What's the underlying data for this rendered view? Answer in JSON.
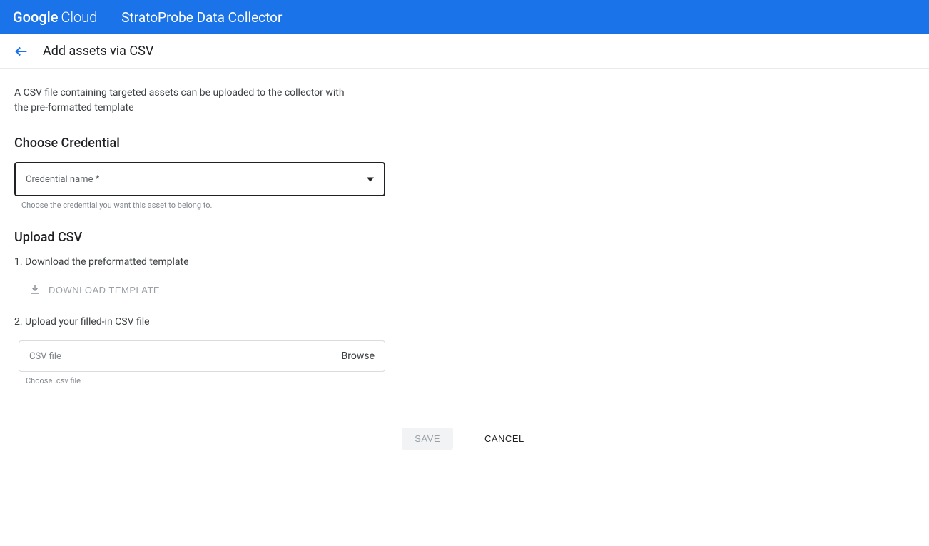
{
  "header": {
    "logo_bold": "Google",
    "logo_light": "Cloud",
    "product_name": "StratoProbe Data Collector"
  },
  "subheader": {
    "title": "Add assets via CSV"
  },
  "main": {
    "intro": "A CSV file containing targeted assets can be uploaded to the collector with the pre-formatted template",
    "credential": {
      "section_title": "Choose Credential",
      "label": "Credential name *",
      "helper": "Choose the credential you want this asset to belong to."
    },
    "upload": {
      "section_title": "Upload CSV",
      "step1": "1. Download the preformatted template",
      "download_button": "DOWNLOAD TEMPLATE",
      "step2": "2. Upload your filled-in CSV file",
      "file_placeholder": "CSV file",
      "browse_label": "Browse",
      "file_helper": "Choose .csv file"
    }
  },
  "footer": {
    "save": "SAVE",
    "cancel": "CANCEL"
  }
}
